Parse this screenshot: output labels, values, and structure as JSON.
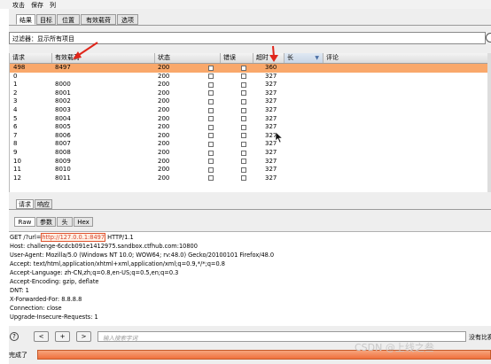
{
  "menu": [
    "攻击",
    "保存",
    "列"
  ],
  "tabs": [
    "结果",
    "目标",
    "位置",
    "有效载荷",
    "选项"
  ],
  "filter": {
    "label": "过滤器：显示所有项目"
  },
  "table": {
    "columns": [
      "请求",
      "有效载荷",
      "状态",
      "错误",
      "超时",
      "长",
      "评论"
    ],
    "rows": [
      {
        "req": "498",
        "payload": "8497",
        "status": "200",
        "len": "360",
        "selected": true
      },
      {
        "req": "0",
        "payload": "",
        "status": "200",
        "len": "327"
      },
      {
        "req": "1",
        "payload": "8000",
        "status": "200",
        "len": "327"
      },
      {
        "req": "2",
        "payload": "8001",
        "status": "200",
        "len": "327"
      },
      {
        "req": "3",
        "payload": "8002",
        "status": "200",
        "len": "327"
      },
      {
        "req": "4",
        "payload": "8003",
        "status": "200",
        "len": "327"
      },
      {
        "req": "5",
        "payload": "8004",
        "status": "200",
        "len": "327"
      },
      {
        "req": "6",
        "payload": "8005",
        "status": "200",
        "len": "327"
      },
      {
        "req": "7",
        "payload": "8006",
        "status": "200",
        "len": "327"
      },
      {
        "req": "8",
        "payload": "8007",
        "status": "200",
        "len": "327"
      },
      {
        "req": "9",
        "payload": "8008",
        "status": "200",
        "len": "327"
      },
      {
        "req": "10",
        "payload": "8009",
        "status": "200",
        "len": "327"
      },
      {
        "req": "11",
        "payload": "8010",
        "status": "200",
        "len": "327"
      },
      {
        "req": "12",
        "payload": "8011",
        "status": "200",
        "len": "327"
      }
    ]
  },
  "reqtabs": [
    "请求",
    "响应"
  ],
  "viewtabs": [
    "Raw",
    "参数",
    "头",
    "Hex"
  ],
  "raw": {
    "line1_pre": "GET /?url=",
    "line1_hl": "http://127.0.0.1:8497",
    "line1_post": " HTTP/1.1",
    "lines": [
      "Host: challenge-6cdcb091e1412975.sandbox.ctfhub.com:10800",
      "User-Agent: Mozilla/5.0 (Windows NT 10.0; WOW64; rv:48.0) Gecko/20100101 Firefox/48.0",
      "Accept: text/html,application/xhtml+xml,application/xml;q=0.9,*/*;q=0.8",
      "Accept-Language: zh-CN,zh;q=0.8,en-US;q=0.5,en;q=0.3",
      "Accept-Encoding: gzip, deflate",
      "DNT: 1",
      "X-Forwarded-For: 8.8.8.8",
      "Connection: close",
      "Upgrade-Insecure-Requests: 1"
    ]
  },
  "bottom": {
    "help": "?",
    "prev": "<",
    "plus": "+",
    "next": ">",
    "search_placeholder": "输入搜索字词",
    "no_match": "没有比赛",
    "status": "完成了"
  },
  "watermark": "CSDN @上线之叁",
  "colors": {
    "selected_row": "#f9a86b",
    "progress": "#f0703c",
    "highlight": "#e0522d"
  }
}
